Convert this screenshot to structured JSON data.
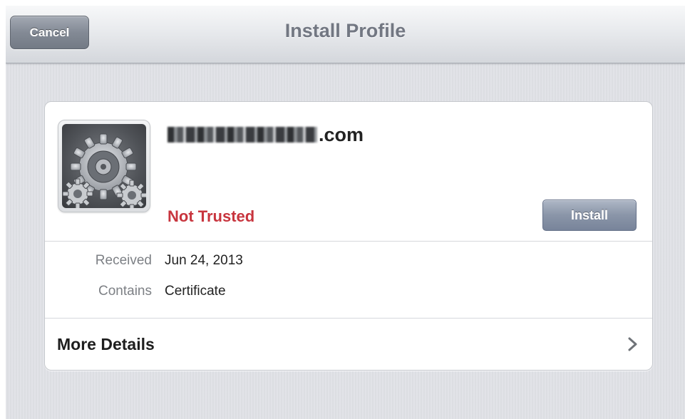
{
  "navbar": {
    "title": "Install Profile",
    "cancel_label": "Cancel"
  },
  "profile": {
    "name_visible_suffix": ".com",
    "trust_status": "Not Trusted",
    "install_label": "Install",
    "icon": "settings-gear-icon"
  },
  "details": [
    {
      "label": "Received",
      "value": "Jun 24, 2013"
    },
    {
      "label": "Contains",
      "value": "Certificate"
    }
  ],
  "more_details": {
    "label": "More Details",
    "icon": "chevron-right-icon"
  },
  "colors": {
    "trust_status": "#c8353e",
    "install_button": "#8a95a8",
    "cancel_button": "#838a95",
    "background": "#dfe1e6"
  }
}
